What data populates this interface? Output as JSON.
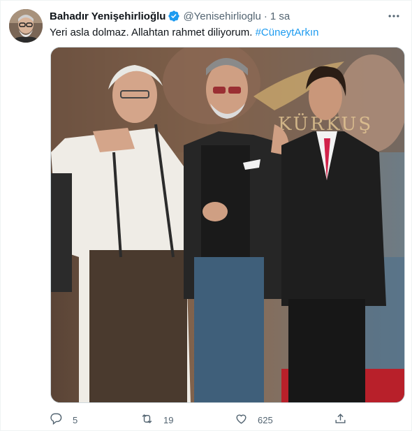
{
  "tweet": {
    "author_name": "Bahadır Yenişehirlioğlu",
    "handle": "@Yenisehirlioglu",
    "separator": "·",
    "time": "1 sa",
    "text": "Yeri asla dolmaz. Allahtan rahmet diliyorum.",
    "hashtag": "#CüneytArkın",
    "image_poster_text": "KÜRKUŞ"
  },
  "actions": {
    "replies": "5",
    "retweets": "19",
    "likes": "625"
  },
  "colors": {
    "accent": "#1d9bf0",
    "secondary_text": "#536471",
    "primary_text": "#0f1419"
  },
  "icons": [
    "verified-badge-icon",
    "more-options-icon",
    "reply-icon",
    "retweet-icon",
    "like-icon",
    "share-icon"
  ]
}
